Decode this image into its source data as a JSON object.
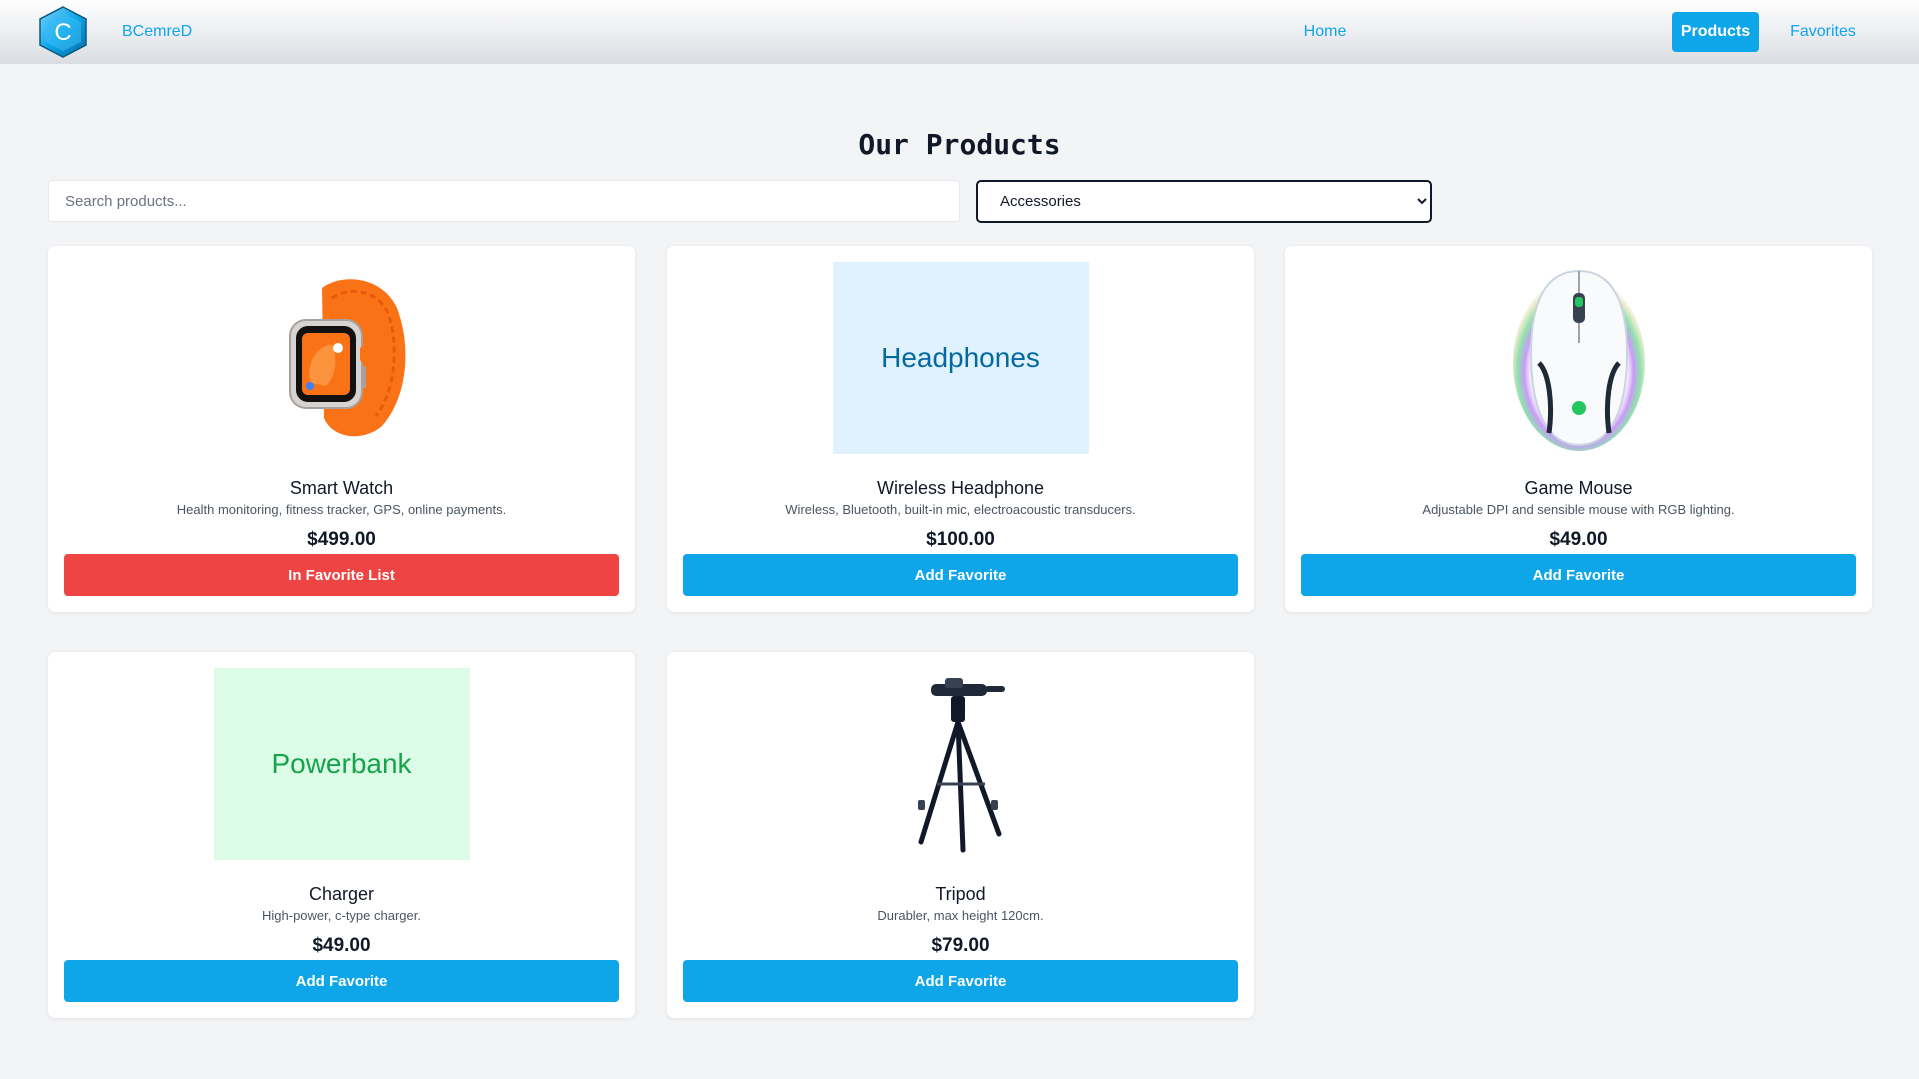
{
  "app": {
    "brand": "BCemreD",
    "logo_letter": "C"
  },
  "nav": {
    "items": [
      {
        "label": "Home",
        "active": false
      },
      {
        "label": "Products",
        "active": true
      },
      {
        "label": "Favorites",
        "active": false
      }
    ]
  },
  "page": {
    "title": "Our Products",
    "search_placeholder": "Search products...",
    "category_selected": "Accessories"
  },
  "products": [
    {
      "name": "Smart Watch",
      "description": "Health monitoring, fitness tracker, GPS, online payments.",
      "price": "$499.00",
      "button": "In Favorite List",
      "favorited": true,
      "image": "watch-icon"
    },
    {
      "name": "Wireless Headphone",
      "description": "Wireless, Bluetooth, built-in mic, electroacoustic transducers.",
      "price": "$100.00",
      "button": "Add Favorite",
      "favorited": false,
      "image_text": "Headphones"
    },
    {
      "name": "Game Mouse",
      "description": "Adjustable DPI and sensible mouse with RGB lighting.",
      "price": "$49.00",
      "button": "Add Favorite",
      "favorited": false,
      "image": "mouse-icon"
    },
    {
      "name": "Charger",
      "description": "High-power, c-type charger.",
      "price": "$49.00",
      "button": "Add Favorite",
      "favorited": false,
      "image_text": "Powerbank"
    },
    {
      "name": "Tripod",
      "description": "Durabler, max height 120cm.",
      "price": "$79.00",
      "button": "Add Favorite",
      "favorited": false,
      "image": "tripod-icon"
    }
  ],
  "colors": {
    "accent": "#0ea5e9",
    "danger": "#ef4444",
    "background": "#f3f4f6"
  }
}
